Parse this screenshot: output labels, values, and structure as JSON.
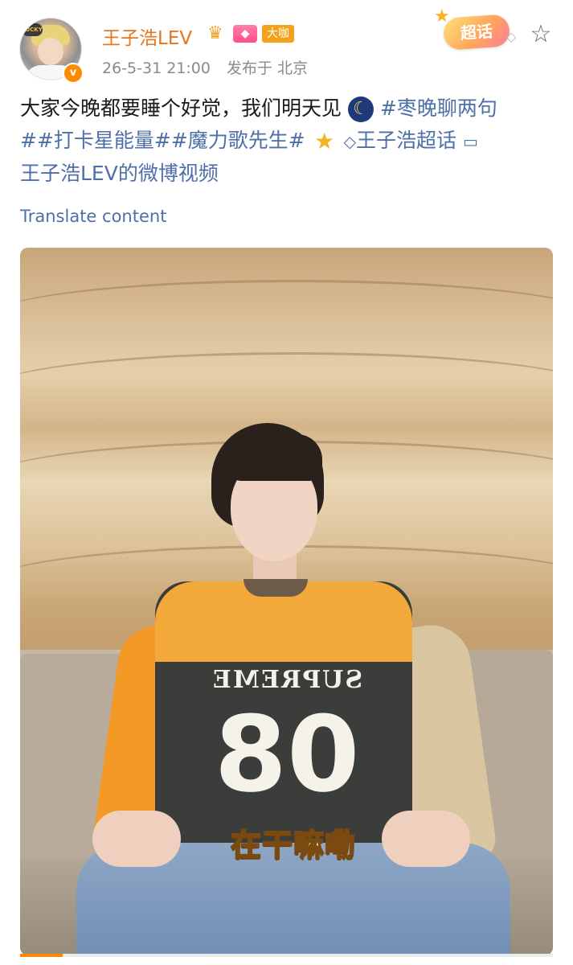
{
  "post": {
    "username": "王子浩LEV",
    "badge_label": "大咖",
    "date": "26-5-31 21:00",
    "source": "发布于 北京",
    "chaohua_label": "超话",
    "text_line1": "大家今晚都要睡个好觉，我们明天见",
    "tag1": "#枣晚聊两句",
    "tag2": "##打卡星能量##魔力歌先生#",
    "super_topic": "王子浩超话",
    "video_link": "王子浩LEV的微博视频",
    "translate": "Translate content"
  },
  "video": {
    "shirt_brand": "SUPREME",
    "shirt_number": "08",
    "subtitle": "在干嘛嘞",
    "progress": 0.08
  },
  "avatar": {
    "cap_text": "LUCKY"
  },
  "icons": {
    "verified": "v-verified-icon",
    "crown": "crown-icon",
    "gem": "gem-icon",
    "favorite": "star-outline-icon",
    "moon": "moon-emoji-icon",
    "star": "star-emoji-icon",
    "super_topic": "diamond-icon",
    "video": "video-camera-icon"
  },
  "colors": {
    "username": "#e8751a",
    "link": "#4e6fa8",
    "meta": "#8a8a8a",
    "badge": "#f3a21a"
  }
}
